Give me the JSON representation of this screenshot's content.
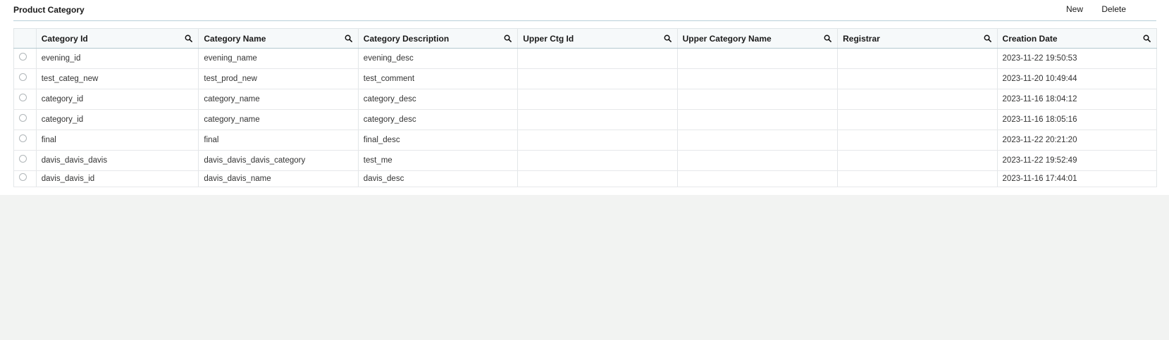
{
  "page": {
    "title": "Product Category",
    "actions": {
      "new_label": "New",
      "delete_label": "Delete"
    }
  },
  "table": {
    "columns": [
      {
        "key": "category_id",
        "label": "Category Id"
      },
      {
        "key": "category_name",
        "label": "Category Name"
      },
      {
        "key": "category_description",
        "label": "Category Description"
      },
      {
        "key": "upper_ctg_id",
        "label": "Upper Ctg Id"
      },
      {
        "key": "upper_category_name",
        "label": "Upper Category Name"
      },
      {
        "key": "registrar",
        "label": "Registrar"
      },
      {
        "key": "creation_date",
        "label": "Creation Date"
      }
    ],
    "rows": [
      {
        "category_id": "evening_id",
        "category_name": "evening_name",
        "category_description": "evening_desc",
        "upper_ctg_id": "",
        "upper_category_name": "",
        "registrar": "",
        "creation_date": "2023-11-22 19:50:53"
      },
      {
        "category_id": "test_categ_new",
        "category_name": "test_prod_new",
        "category_description": "test_comment",
        "upper_ctg_id": "",
        "upper_category_name": "",
        "registrar": "",
        "creation_date": "2023-11-20 10:49:44"
      },
      {
        "category_id": "category_id",
        "category_name": "category_name",
        "category_description": "category_desc",
        "upper_ctg_id": "",
        "upper_category_name": "",
        "registrar": "",
        "creation_date": "2023-11-16 18:04:12"
      },
      {
        "category_id": "category_id",
        "category_name": "category_name",
        "category_description": "category_desc",
        "upper_ctg_id": "",
        "upper_category_name": "",
        "registrar": "",
        "creation_date": "2023-11-16 18:05:16"
      },
      {
        "category_id": "final",
        "category_name": "final",
        "category_description": "final_desc",
        "upper_ctg_id": "",
        "upper_category_name": "",
        "registrar": "",
        "creation_date": "2023-11-22 20:21:20"
      },
      {
        "category_id": "davis_davis_davis",
        "category_name": "davis_davis_davis_category",
        "category_description": "test_me",
        "upper_ctg_id": "",
        "upper_category_name": "",
        "registrar": "",
        "creation_date": "2023-11-22 19:52:49"
      },
      {
        "category_id": "davis_davis_id",
        "category_name": "davis_davis_name",
        "category_description": "davis_desc",
        "upper_ctg_id": "",
        "upper_category_name": "",
        "registrar": "",
        "creation_date": "2023-11-16 17:44:01"
      }
    ]
  },
  "icons": {
    "column_search": "search-icon",
    "row_select": "radio-button"
  },
  "colors": {
    "link_text": "#3d6f80",
    "header_bg": "#f6f9fa",
    "page_bg": "#f2f3f2"
  }
}
